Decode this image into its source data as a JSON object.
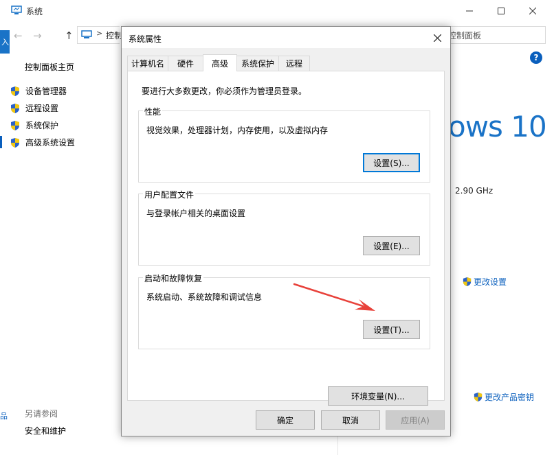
{
  "background_window": {
    "title": "系统",
    "address_fragment": "控制",
    "search_placeholder": "控制面板",
    "left_panel": {
      "home": "控制面板主页",
      "items": [
        {
          "label": "设备管理器",
          "icon": "shield-icon"
        },
        {
          "label": "远程设置",
          "icon": "shield-icon"
        },
        {
          "label": "系统保护",
          "icon": "shield-icon"
        },
        {
          "label": "高级系统设置",
          "icon": "shield-icon"
        }
      ],
      "see_also": "另请参阅",
      "security": "安全和维护"
    },
    "right_panel": {
      "windows_logo_text": "ows 10",
      "cpu_speed": "2.90 GHz",
      "change_settings": "更改设置",
      "change_product_key": "更改产品密钥"
    },
    "left_edge_glyph": "入",
    "left_cut_text": "品"
  },
  "dialog": {
    "title": "系统属性",
    "tabs": [
      {
        "label": "计算机名",
        "active": false
      },
      {
        "label": "硬件",
        "active": false
      },
      {
        "label": "高级",
        "active": true
      },
      {
        "label": "系统保护",
        "active": false
      },
      {
        "label": "远程",
        "active": false
      }
    ],
    "admin_note": "要进行大多数更改，你必须作为管理员登录。",
    "groups": {
      "performance": {
        "label": "性能",
        "description": "视觉效果，处理器计划，内存使用，以及虚拟内存",
        "button": "设置(S)..."
      },
      "user_profiles": {
        "label": "用户配置文件",
        "description": "与登录帐户相关的桌面设置",
        "button": "设置(E)..."
      },
      "startup_recovery": {
        "label": "启动和故障恢复",
        "description": "系统启动、系统故障和调试信息",
        "button": "设置(T)..."
      }
    },
    "env_button": "环境变量(N)...",
    "ok_button": "确定",
    "cancel_button": "取消",
    "apply_button": "应用(A)"
  },
  "colors": {
    "accent": "#0078d7",
    "link": "#0a5fbd",
    "annotation_arrow": "#e8413a"
  }
}
